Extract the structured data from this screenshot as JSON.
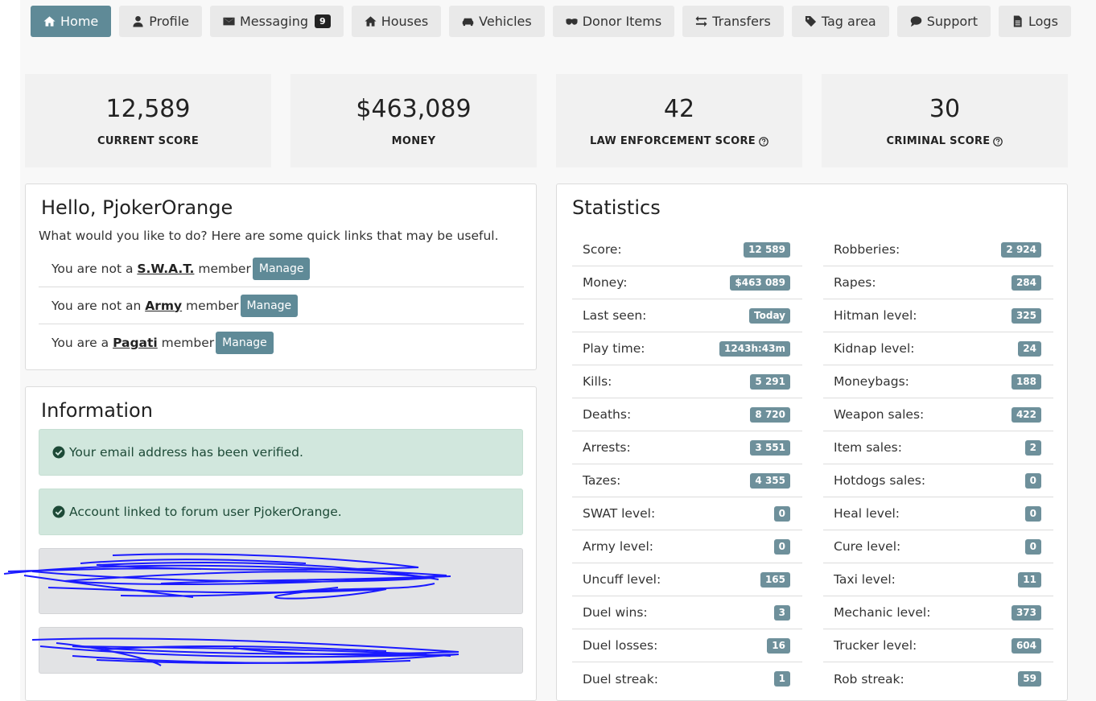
{
  "nav": [
    {
      "label": "Home",
      "icon": "home-icon",
      "active": true
    },
    {
      "label": "Profile",
      "icon": "user-icon"
    },
    {
      "label": "Messaging",
      "icon": "envelope-icon",
      "badge": "9"
    },
    {
      "label": "Houses",
      "icon": "home-icon"
    },
    {
      "label": "Vehicles",
      "icon": "car-icon"
    },
    {
      "label": "Donor Items",
      "icon": "mask-icon"
    },
    {
      "label": "Transfers",
      "icon": "arrows-icon"
    },
    {
      "label": "Tag area",
      "icon": "tag-icon"
    },
    {
      "label": "Support",
      "icon": "chat-icon"
    },
    {
      "label": "Logs",
      "icon": "file-icon"
    }
  ],
  "summary": [
    {
      "value": "12,589",
      "label": "CURRENT SCORE",
      "help": false
    },
    {
      "value": "$463,089",
      "label": "MONEY",
      "help": false
    },
    {
      "value": "42",
      "label": "LAW ENFORCEMENT SCORE",
      "help": true
    },
    {
      "value": "30",
      "label": "CRIMINAL SCORE",
      "help": true
    }
  ],
  "hello": {
    "title": "Hello, PjokerOrange",
    "intro": "What would you like to do? Here are some quick links that may be useful.",
    "rows": [
      {
        "pre": "You are not a ",
        "org": "S.W.A.T.",
        "post": " member",
        "button": "Manage"
      },
      {
        "pre": "You are not an ",
        "org": "Army",
        "post": " member",
        "button": "Manage"
      },
      {
        "pre": "You are a ",
        "org": "Pagati",
        "post": " member",
        "button": "Manage"
      }
    ]
  },
  "info": {
    "title": "Information",
    "alerts": [
      "Your email address has been verified.",
      "Account linked to forum user PjokerOrange."
    ]
  },
  "stats": {
    "title": "Statistics",
    "left": [
      {
        "label": "Score:",
        "value": "12 589"
      },
      {
        "label": "Money:",
        "value": "$463 089"
      },
      {
        "label": "Last seen:",
        "value": "Today"
      },
      {
        "label": "Play time:",
        "value": "1243h:43m"
      },
      {
        "label": "Kills:",
        "value": "5 291"
      },
      {
        "label": "Deaths:",
        "value": "8 720"
      },
      {
        "label": "Arrests:",
        "value": "3 551"
      },
      {
        "label": "Tazes:",
        "value": "4 355"
      },
      {
        "label": "SWAT level:",
        "value": "0"
      },
      {
        "label": "Army level:",
        "value": "0"
      },
      {
        "label": "Uncuff level:",
        "value": "165"
      },
      {
        "label": "Duel wins:",
        "value": "3"
      },
      {
        "label": "Duel losses:",
        "value": "16"
      },
      {
        "label": "Duel streak:",
        "value": "1"
      }
    ],
    "right": [
      {
        "label": "Robberies:",
        "value": "2 924"
      },
      {
        "label": "Rapes:",
        "value": "284"
      },
      {
        "label": "Hitman level:",
        "value": "325"
      },
      {
        "label": "Kidnap level:",
        "value": "24"
      },
      {
        "label": "Moneybags:",
        "value": "188"
      },
      {
        "label": "Weapon sales:",
        "value": "422"
      },
      {
        "label": "Item sales:",
        "value": "2"
      },
      {
        "label": "Hotdogs sales:",
        "value": "0"
      },
      {
        "label": "Heal level:",
        "value": "0"
      },
      {
        "label": "Cure level:",
        "value": "0"
      },
      {
        "label": "Taxi level:",
        "value": "11"
      },
      {
        "label": "Mechanic level:",
        "value": "373"
      },
      {
        "label": "Trucker level:",
        "value": "604"
      },
      {
        "label": "Rob streak:",
        "value": "59"
      }
    ]
  },
  "colors": {
    "accent": "#5f8a97",
    "badge": "#6e909b",
    "redaction": "#1a1aff"
  }
}
